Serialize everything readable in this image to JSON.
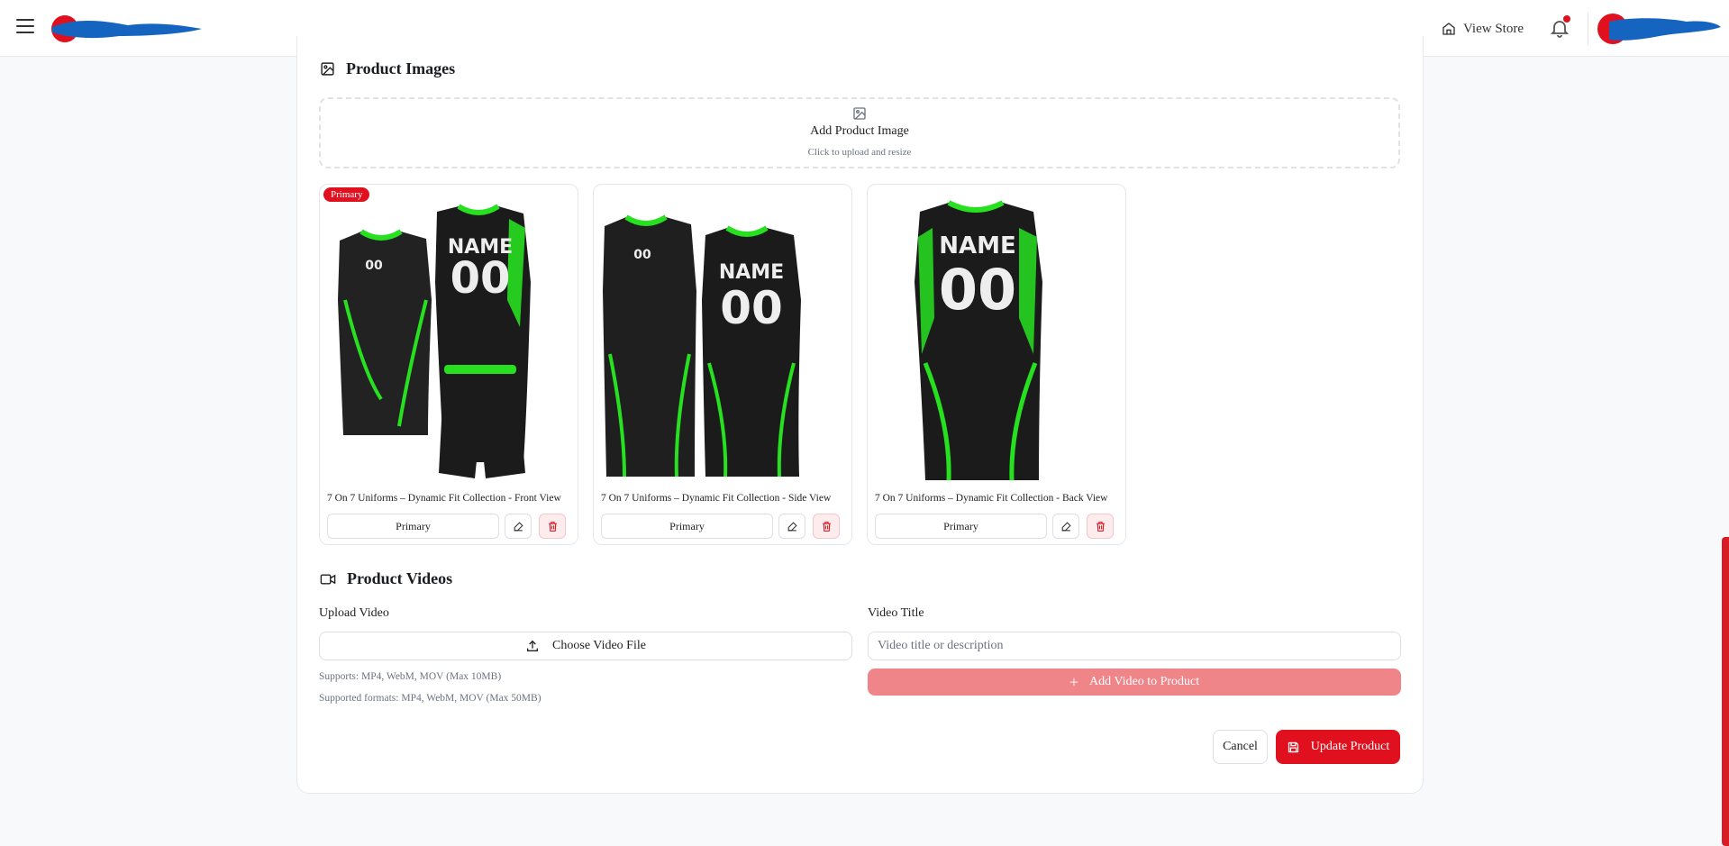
{
  "header": {
    "view_store_label": "View Store"
  },
  "product_images": {
    "title": "Product Images",
    "upload": {
      "title": "Add Product Image",
      "subtitle": "Click to upload and resize"
    },
    "primary_badge": "Primary",
    "images": [
      {
        "caption": "7 On 7 Uniforms – Dynamic Fit Collection - Front View",
        "primary_button": "Primary",
        "jersey_name": "NAME",
        "jersey_number": "00"
      },
      {
        "caption": "7 On 7 Uniforms – Dynamic Fit Collection - Side View",
        "primary_button": "Primary",
        "jersey_name": "NAME",
        "jersey_number": "00"
      },
      {
        "caption": "7 On 7 Uniforms – Dynamic Fit Collection - Back View",
        "primary_button": "Primary",
        "jersey_name": "NAME",
        "jersey_number": "00"
      }
    ]
  },
  "product_videos": {
    "title": "Product Videos",
    "upload_label": "Upload Video",
    "choose_file_label": "Choose Video File",
    "help_1": "Supports: MP4, WebM, MOV (Max 10MB)",
    "help_2": "Supported formats: MP4, WebM, MOV (Max 50MB)",
    "video_title_label": "Video Title",
    "video_title_placeholder": "Video title or description",
    "add_video_label": "Add Video to Product"
  },
  "actions": {
    "cancel_label": "Cancel",
    "update_label": "Update Product"
  },
  "colors": {
    "accent": "#e0101e",
    "accent_light": "#f08589",
    "jersey_green": "#27e020"
  }
}
